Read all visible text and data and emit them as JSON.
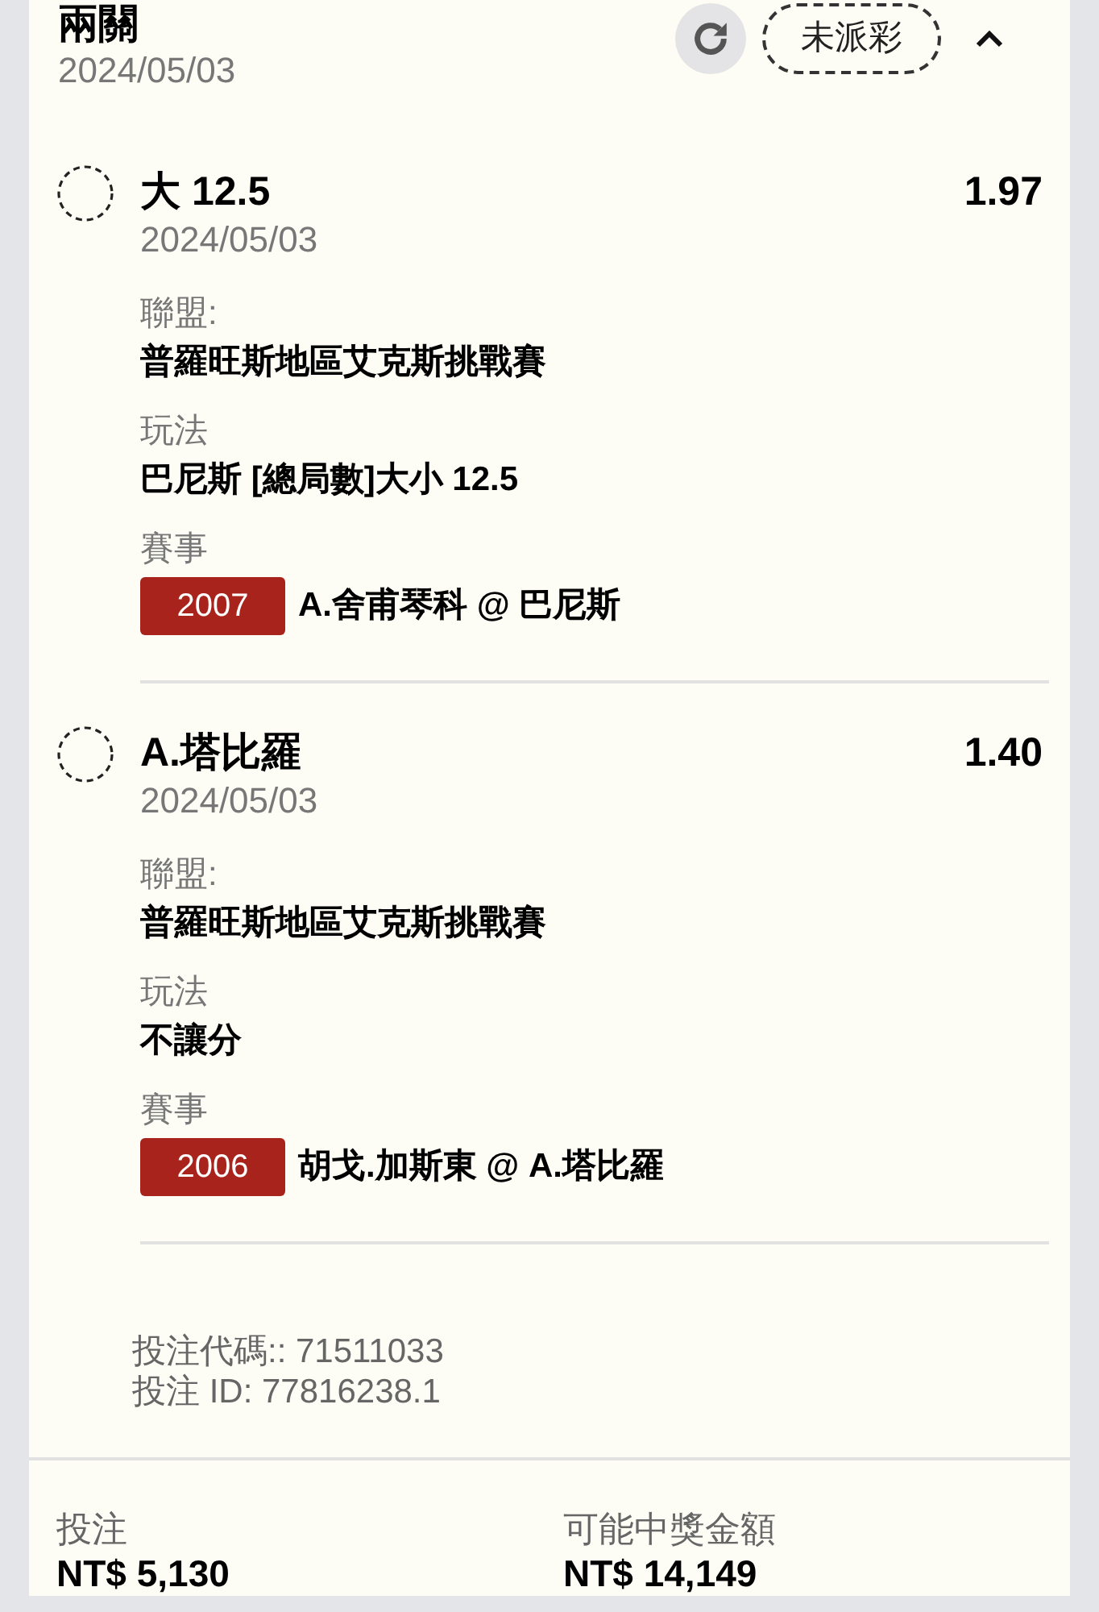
{
  "header": {
    "title": "兩關",
    "date": "2024/05/03",
    "status": "未派彩",
    "expanded": true
  },
  "legs": [
    {
      "selection": "大 12.5",
      "date": "2024/05/03",
      "odds": "1.97",
      "league_label": "聯盟:",
      "league": "普羅旺斯地區艾克斯挑戰賽",
      "market_label": "玩法",
      "market": "巴尼斯 [總局數]大小 12.5",
      "event_label": "賽事",
      "event_code": "2007",
      "event": "A.舍甫琴科 @ 巴尼斯"
    },
    {
      "selection": "A.塔比羅",
      "date": "2024/05/03",
      "odds": "1.40",
      "league_label": "聯盟:",
      "league": "普羅旺斯地區艾克斯挑戰賽",
      "market_label": "玩法",
      "market": "不讓分",
      "event_label": "賽事",
      "event_code": "2006",
      "event": "胡戈.加斯東 @ A.塔比羅"
    }
  ],
  "bet_code": "投注代碼:: 71511033",
  "bet_id": "投注 ID: 77816238.1",
  "summary": [
    {
      "label": "投注",
      "value": "NT$ 5,130"
    },
    {
      "label": "可能中獎金額",
      "value": "NT$ 14,149"
    }
  ]
}
